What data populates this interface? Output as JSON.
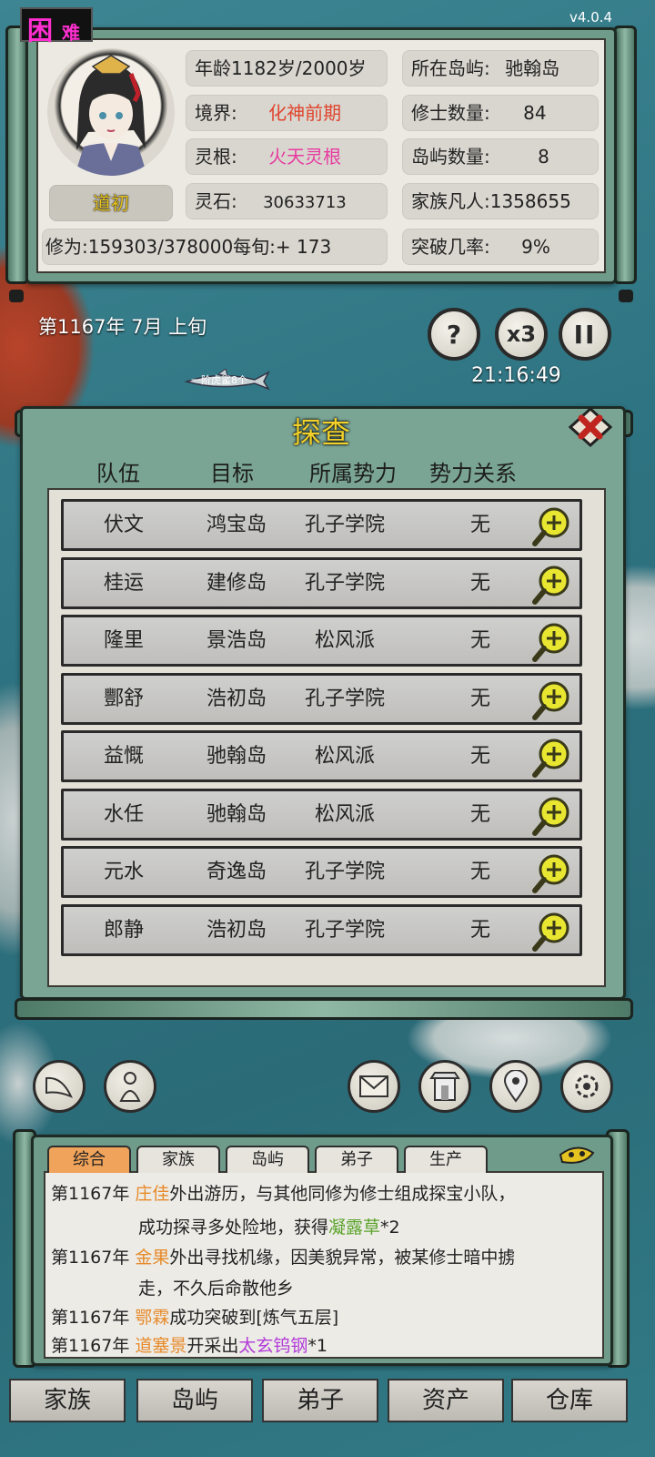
{
  "version": "v4.0.4",
  "difficulty": {
    "char1": "困",
    "char2": "难"
  },
  "character": {
    "name": "道初",
    "age": "年龄1182岁/2000岁",
    "realm_label": "境界:",
    "realm_value": "化神前期",
    "root_label": "灵根:",
    "root_value": "火天灵根",
    "stones_label": "灵石:",
    "stones_value": "30633713",
    "cultivation": "修为:159303/378000每旬:+ 173",
    "island_label": "所在岛屿:",
    "island_value": "驰翰岛",
    "cultivators_label": "修士数量:",
    "cultivators_value": "84",
    "islands_label": "岛屿数量:",
    "islands_value": "8",
    "mortals": "家族凡人:1358655",
    "breakthrough_label": "突破几率:",
    "breakthrough_value": "9%"
  },
  "date": "第1167年 7月 上旬",
  "clock": "21:16:49",
  "controls": {
    "help": "?",
    "speed": "x3",
    "pause": "II"
  },
  "map_label": "一阶虎鲨8个",
  "explore": {
    "title": "探查",
    "columns": [
      "队伍",
      "目标",
      "所属势力",
      "势力关系"
    ],
    "rows": [
      {
        "team": "伏文",
        "target": "鸿宝岛",
        "faction": "孔子学院",
        "relation": "无"
      },
      {
        "team": "桂运",
        "target": "建修岛",
        "faction": "孔子学院",
        "relation": "无"
      },
      {
        "team": "隆里",
        "target": "景浩岛",
        "faction": "松风派",
        "relation": "无"
      },
      {
        "team": "酆舒",
        "target": "浩初岛",
        "faction": "孔子学院",
        "relation": "无"
      },
      {
        "team": "益慨",
        "target": "驰翰岛",
        "faction": "松风派",
        "relation": "无"
      },
      {
        "team": "水任",
        "target": "驰翰岛",
        "faction": "松风派",
        "relation": "无"
      },
      {
        "team": "元水",
        "target": "奇逸岛",
        "faction": "孔子学院",
        "relation": "无"
      },
      {
        "team": "郎静",
        "target": "浩初岛",
        "faction": "孔子学院",
        "relation": "无"
      }
    ]
  },
  "log": {
    "tabs": [
      "综合",
      "家族",
      "岛屿",
      "弟子",
      "生产"
    ],
    "lines": [
      {
        "year": "第1167年",
        "name": "庄佳",
        "text": "外出游历，与其他同修为修士组成探宝小队，",
        "item": "",
        "suffix": ""
      },
      {
        "year": "",
        "name": "",
        "text": "成功探寻多处险地，获得",
        "item": "凝露草",
        "suffix": "*2"
      },
      {
        "year": "第1167年",
        "name": "金果",
        "text": "外出寻找机缘，因美貌异常，被某修士暗中掳",
        "item": "",
        "suffix": ""
      },
      {
        "year": "",
        "name": "",
        "text": "走，不久后命散他乡",
        "item": "",
        "suffix": ""
      },
      {
        "year": "第1167年",
        "name": "鄂霖",
        "text": "成功突破到[炼气五层]",
        "item": "",
        "suffix": ""
      },
      {
        "year": "第1167年",
        "name": "道塞景",
        "text": "开采出",
        "item": "太玄钨钢",
        "suffix": "*1"
      }
    ]
  },
  "nav": [
    "家族",
    "岛屿",
    "弟子",
    "资产",
    "仓库"
  ],
  "colors": {
    "realm": "#e0452e",
    "root": "#e83aa0",
    "name": "#e88a2a",
    "herb": "#5aa32a",
    "ore": "#b23ad8",
    "player": "#e6c21a"
  }
}
